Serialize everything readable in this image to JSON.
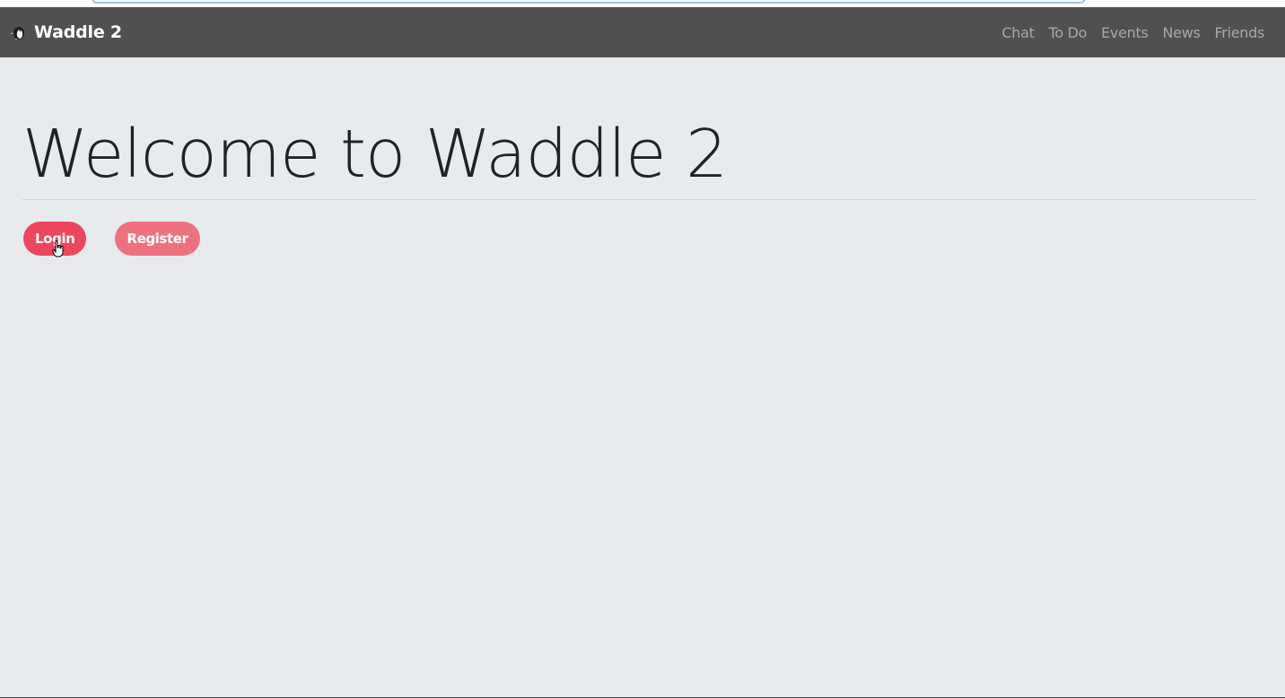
{
  "app": {
    "brand_name": "Waddle 2",
    "brand_icon": "penguin-icon"
  },
  "nav": {
    "items": [
      {
        "label": "Chat"
      },
      {
        "label": "To Do"
      },
      {
        "label": "Events"
      },
      {
        "label": "News"
      },
      {
        "label": "Friends"
      }
    ]
  },
  "main": {
    "title": "Welcome to Waddle 2",
    "login_label": "Login",
    "register_label": "Register"
  },
  "colors": {
    "navbar": "#505050",
    "background": "#e7ebee",
    "login": "#ec475e",
    "register": "#ee7180"
  }
}
